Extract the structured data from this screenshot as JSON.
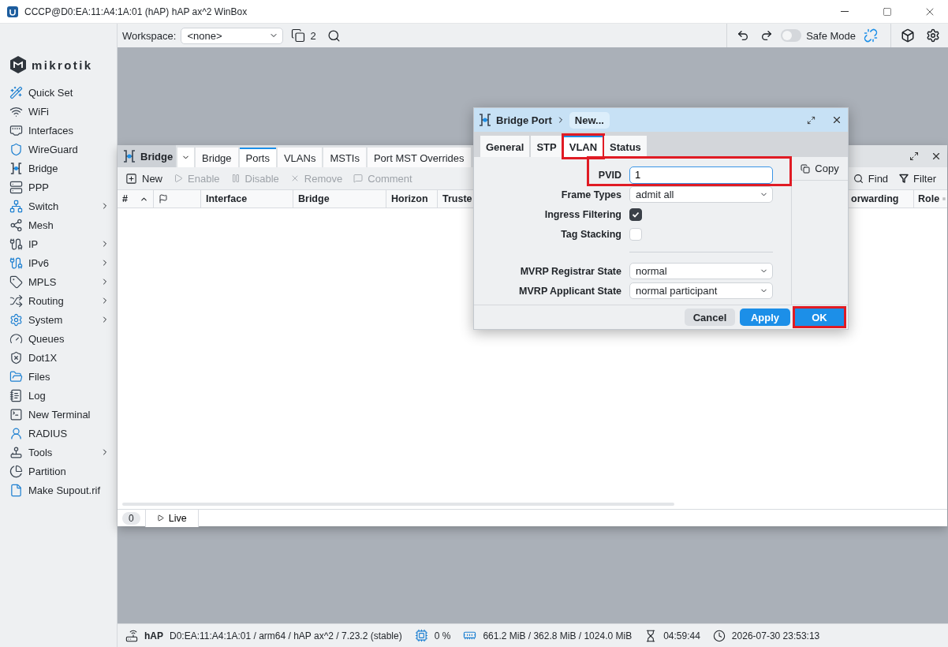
{
  "window": {
    "title": "CCCP@D0:EA:11:A4:1A:01 (hAP) hAP ax^2 WinBox"
  },
  "sidebar": {
    "logo": "mikrotik",
    "items": [
      {
        "label": "Quick Set",
        "has_submenu": false
      },
      {
        "label": "WiFi",
        "has_submenu": false
      },
      {
        "label": "Interfaces",
        "has_submenu": false
      },
      {
        "label": "WireGuard",
        "has_submenu": false
      },
      {
        "label": "Bridge",
        "has_submenu": false
      },
      {
        "label": "PPP",
        "has_submenu": false
      },
      {
        "label": "Switch",
        "has_submenu": true
      },
      {
        "label": "Mesh",
        "has_submenu": false
      },
      {
        "label": "IP",
        "has_submenu": true
      },
      {
        "label": "IPv6",
        "has_submenu": true
      },
      {
        "label": "MPLS",
        "has_submenu": true
      },
      {
        "label": "Routing",
        "has_submenu": true
      },
      {
        "label": "System",
        "has_submenu": true
      },
      {
        "label": "Queues",
        "has_submenu": false
      },
      {
        "label": "Dot1X",
        "has_submenu": false
      },
      {
        "label": "Files",
        "has_submenu": false
      },
      {
        "label": "Log",
        "has_submenu": false
      },
      {
        "label": "New Terminal",
        "has_submenu": false
      },
      {
        "label": "RADIUS",
        "has_submenu": false
      },
      {
        "label": "Tools",
        "has_submenu": true
      },
      {
        "label": "Partition",
        "has_submenu": false
      },
      {
        "label": "Make Supout.rif",
        "has_submenu": false
      }
    ]
  },
  "toolbar": {
    "workspace_label": "Workspace:",
    "workspace_value": "<none>",
    "window_count": "2",
    "safe_mode": {
      "label": "Safe Mode",
      "on": false
    }
  },
  "bridge_window": {
    "title": "Bridge",
    "tabs": [
      {
        "label": "Bridge",
        "selected": false
      },
      {
        "label": "Ports",
        "selected": true
      },
      {
        "label": "VLANs",
        "selected": false
      },
      {
        "label": "MSTIs",
        "selected": false
      },
      {
        "label": "Port MST Overrides",
        "selected": false
      }
    ],
    "actions": [
      {
        "label": "New",
        "disabled": false
      },
      {
        "label": "Enable",
        "disabled": true
      },
      {
        "label": "Disable",
        "disabled": true
      },
      {
        "label": "Remove",
        "disabled": true
      },
      {
        "label": "Comment",
        "disabled": true
      }
    ],
    "right_actions": [
      "Find",
      "Filter"
    ],
    "columns": [
      {
        "kind": "index",
        "label": "#"
      },
      {
        "kind": "flag"
      },
      {
        "kind": "text",
        "label": "Interface"
      },
      {
        "kind": "text",
        "label": "Bridge"
      },
      {
        "kind": "text",
        "label": "Horizon"
      },
      {
        "kind": "text",
        "label": "Truste"
      }
    ],
    "right_columns": [
      {
        "label": "orwarding"
      },
      {
        "label": "Role"
      }
    ],
    "count": "0",
    "live_label": "Live"
  },
  "dialog": {
    "title": "Bridge Port",
    "breadcrumb": "New...",
    "tabs": [
      {
        "label": "General",
        "selected": false,
        "highlighted": false
      },
      {
        "label": "STP",
        "selected": false,
        "highlighted": false
      },
      {
        "label": "VLAN",
        "selected": true,
        "highlighted": true
      },
      {
        "label": "Status",
        "selected": false,
        "highlighted": false
      }
    ],
    "fields": [
      {
        "kind": "text",
        "label": "PVID",
        "value": "1",
        "highlighted": true
      },
      {
        "kind": "select",
        "label": "Frame Types",
        "value": "admit all",
        "highlighted": false
      },
      {
        "kind": "checkbox",
        "label": "Ingress Filtering",
        "checked": true,
        "highlighted": false
      },
      {
        "kind": "checkbox",
        "label": "Tag Stacking",
        "checked": false,
        "highlighted": false
      },
      {
        "kind": "separator"
      },
      {
        "kind": "select",
        "label": "MVRP Registrar State",
        "value": "normal",
        "highlighted": false
      },
      {
        "kind": "select",
        "label": "MVRP Applicant State",
        "value": "normal participant",
        "highlighted": false
      }
    ],
    "side_buttons": [
      "Copy"
    ],
    "buttons": [
      {
        "kind": "secondary",
        "label": "Cancel",
        "highlighted": false
      },
      {
        "kind": "primary",
        "label": "Apply",
        "highlighted": false
      },
      {
        "kind": "primary",
        "label": "OK",
        "highlighted": true
      }
    ]
  },
  "status_bar": {
    "device": "hAP",
    "info": "D0:EA:11:A4:1A:01 / arm64 / hAP ax^2 / 7.23.2 (stable)",
    "cpu": "0 %",
    "memory": "661.2 MiB / 362.8 MiB / 1024.0 MiB",
    "uptime": "04:59:44",
    "clock": "2026-07-30 23:53:13"
  }
}
